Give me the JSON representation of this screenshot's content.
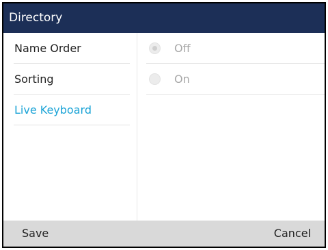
{
  "header": {
    "title": "Directory"
  },
  "menu": {
    "items": [
      {
        "label": "Name Order",
        "active": false
      },
      {
        "label": "Sorting",
        "active": false
      },
      {
        "label": "Live Keyboard",
        "active": true
      }
    ]
  },
  "options": [
    {
      "label": "Off",
      "selected": true
    },
    {
      "label": "On",
      "selected": false
    }
  ],
  "softkeys": {
    "save_label": "Save",
    "cancel_label": "Cancel"
  },
  "colors": {
    "header_bg": "#1c2f57",
    "active_item": "#1aa3d6",
    "softkey_bar": "#d9d9d9",
    "option_text": "#a8a8a8"
  }
}
